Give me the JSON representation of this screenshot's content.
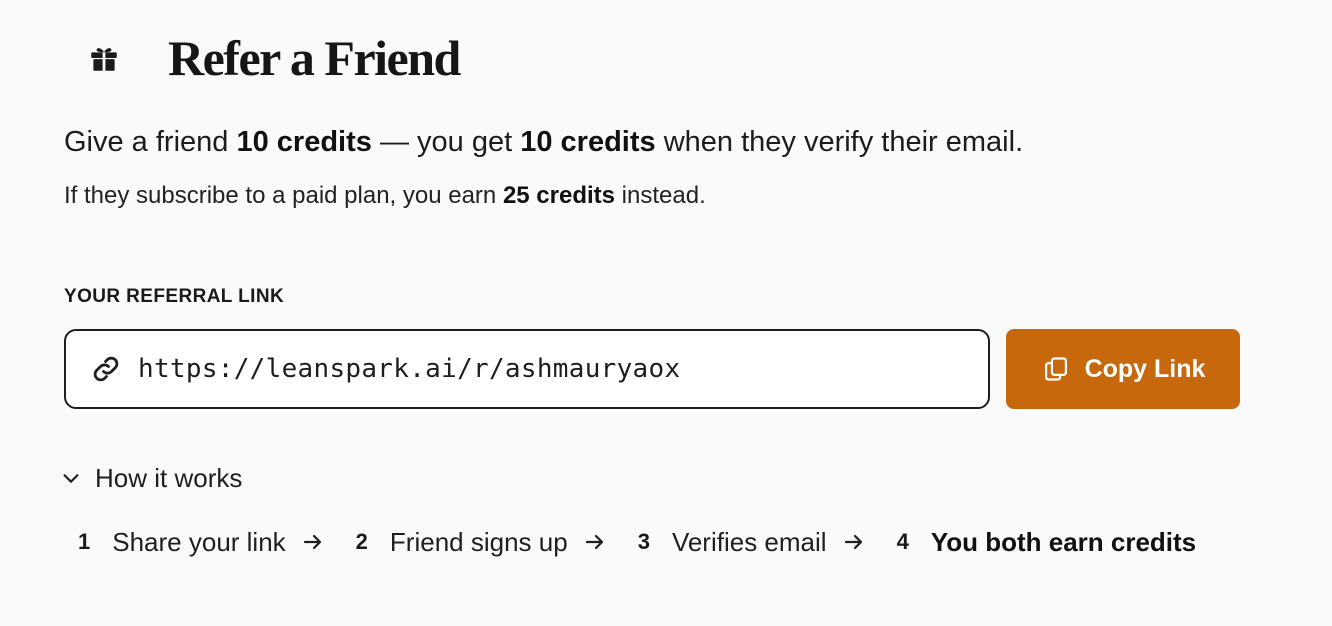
{
  "header": {
    "icon": "gift-icon",
    "title": "Refer a Friend"
  },
  "intro": {
    "line1_a": "Give a friend ",
    "line1_b": "10 credits",
    "line1_c": " — you get ",
    "line1_d": "10 credits",
    "line1_e": " when they verify their email.",
    "line2_a": "If they subscribe to a paid plan, you earn ",
    "line2_b": "25 credits",
    "line2_c": " instead."
  },
  "referral": {
    "label": "YOUR REFERRAL LINK",
    "link_icon": "link-icon",
    "url": "https://leanspark.ai/r/ashmauryaox",
    "copy_icon": "copy-icon",
    "copy_label": "Copy Link"
  },
  "how_it_works": {
    "toggle_icon": "chevron-down-icon",
    "label": "How it works",
    "steps": [
      {
        "number": "1",
        "label": "Share your link"
      },
      {
        "number": "2",
        "label": "Friend signs up"
      },
      {
        "number": "3",
        "label": "Verifies email"
      },
      {
        "number": "4",
        "label": "You both earn credits"
      }
    ]
  },
  "colors": {
    "accent": "#c8680c",
    "background": "#fafafa",
    "text": "#1a1a1a"
  }
}
